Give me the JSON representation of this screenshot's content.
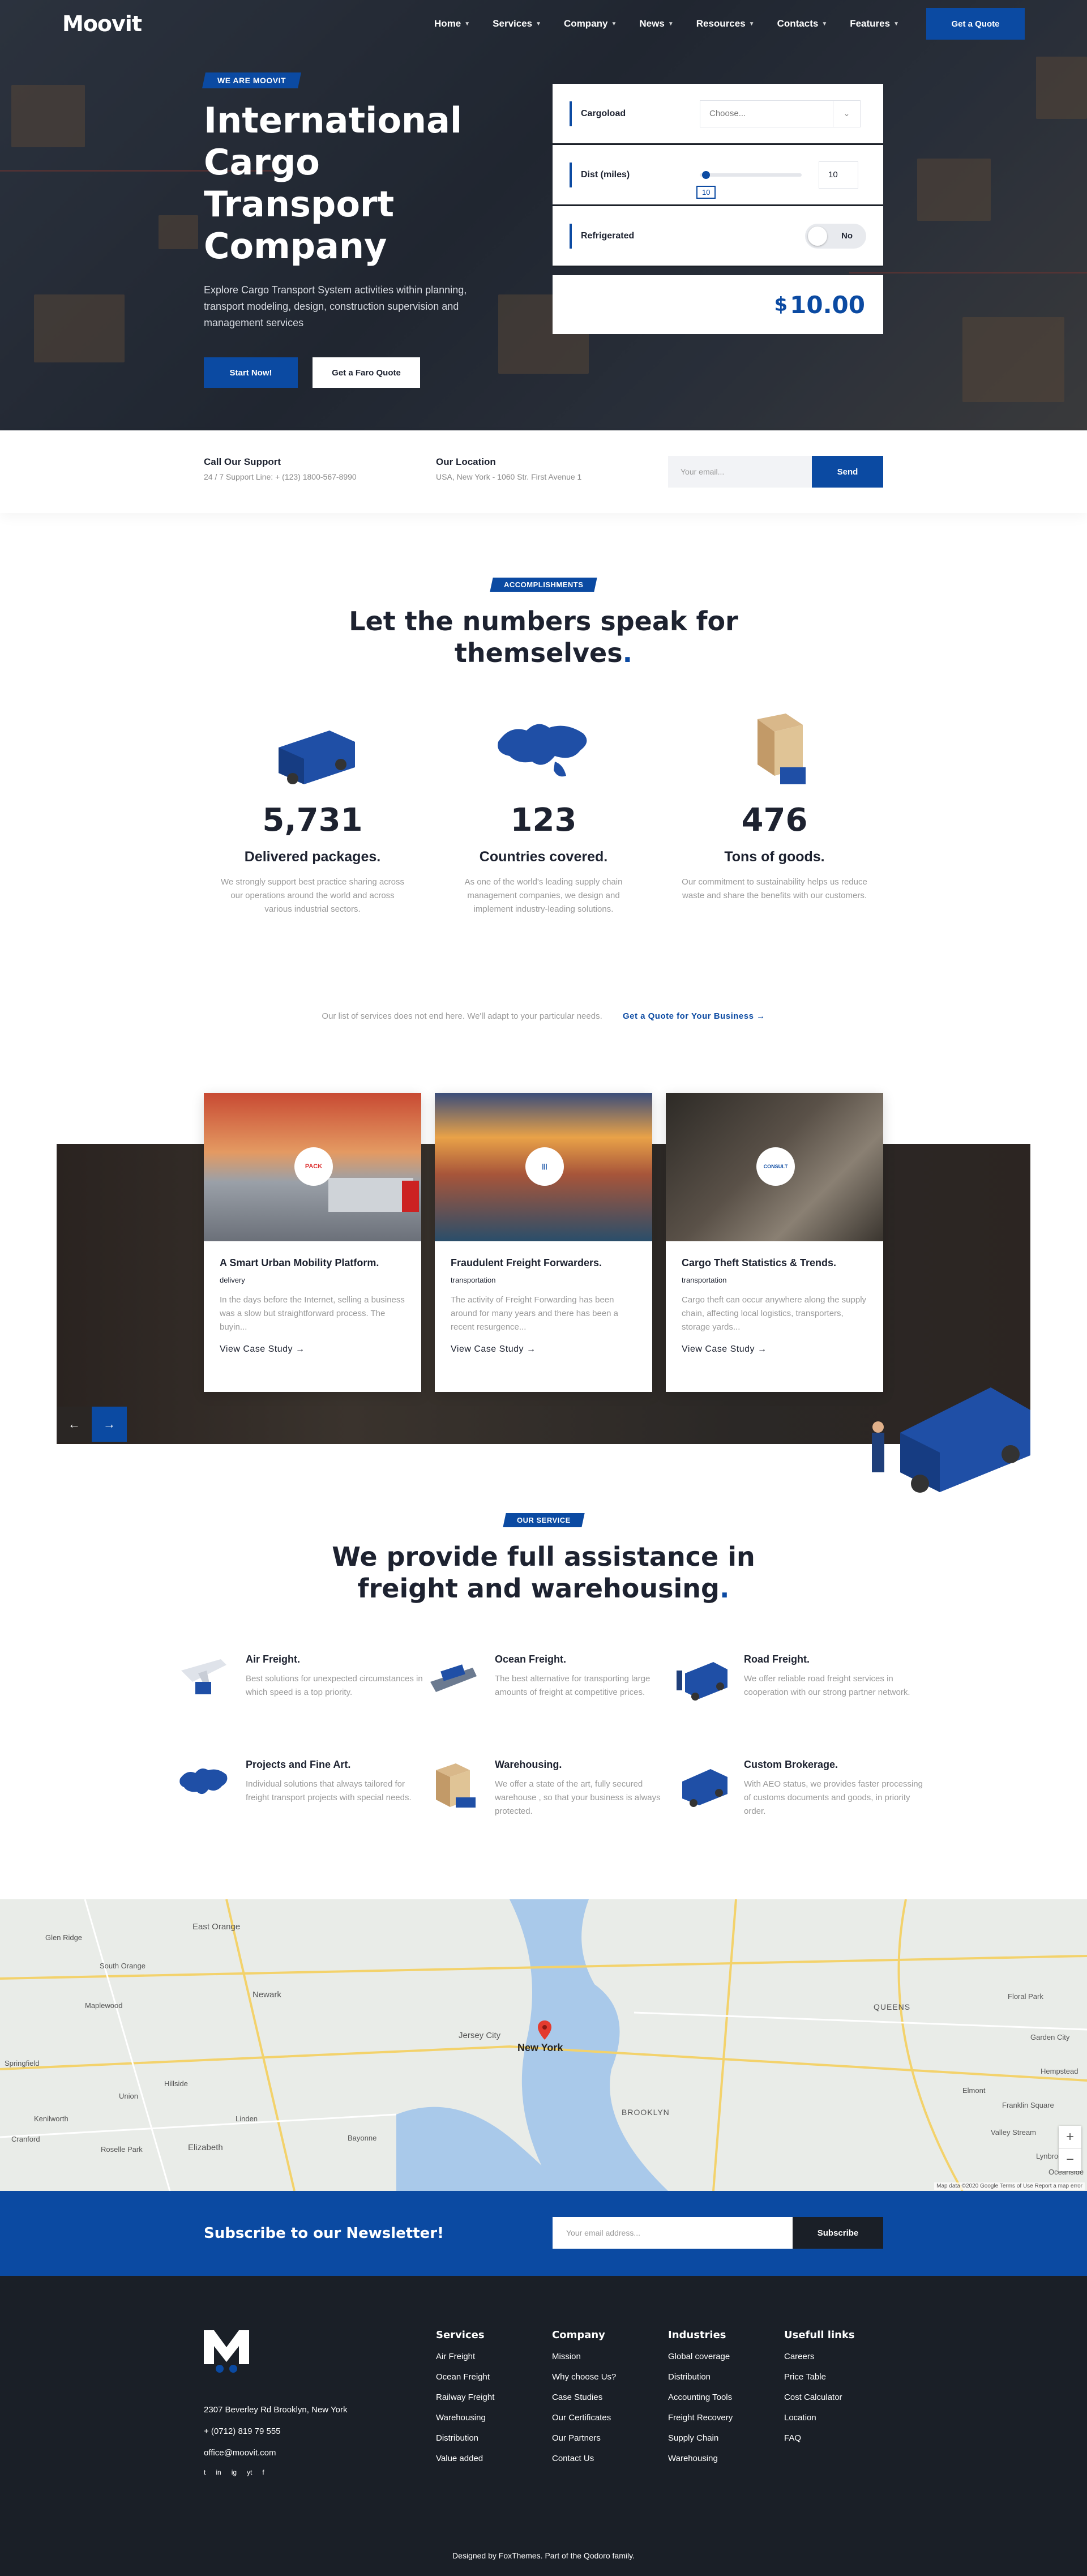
{
  "nav": {
    "logo": "Moovit",
    "items": [
      "Home",
      "Services",
      "Company",
      "News",
      "Resources",
      "Contacts",
      "Features"
    ],
    "quote_button": "Get a Quote"
  },
  "hero": {
    "tag": "WE ARE MOOVIT",
    "title_lines": [
      "International",
      "Cargo Transport",
      "Company"
    ],
    "subtitle": "Explore Cargo Transport System activities within planning, transport modeling, design, construction supervision and management services",
    "btn_primary": "Start Now!",
    "btn_secondary": "Get a Faro Quote"
  },
  "calculator": {
    "cargoload_label": "Cargoload",
    "cargoload_placeholder": "Choose...",
    "dist_label": "Dist (miles)",
    "dist_value": "10",
    "dist_tooltip": "10",
    "refrigerated_label": "Refrigerated",
    "refrigerated_value": "No",
    "total_currency": "$",
    "total_amount": "10.00"
  },
  "contact_bar": {
    "support_title": "Call Our Support",
    "support_text": "24 / 7 Support Line: + (123) 1800-567-8990",
    "location_title": "Our Location",
    "location_text": "USA, New York - 1060 Str. First Avenue 1",
    "email_placeholder": "Your email...",
    "send_label": "Send"
  },
  "accomplishments": {
    "tag": "ACCOMPLISHMENTS",
    "heading_lines": [
      "Let the numbers speak for",
      "themselves"
    ],
    "stats": [
      {
        "num": "5,731",
        "title": "Delivered packages.",
        "desc": "We strongly support best practice sharing across our operations around the world and across various industrial sectors."
      },
      {
        "num": "123",
        "title": "Countries covered.",
        "desc": "As one of the world's leading supply chain management companies, we design and implement industry-leading solutions."
      },
      {
        "num": "476",
        "title": "Tons of goods.",
        "desc": "Our commitment to sustainability helps us reduce waste and share the benefits with our customers."
      }
    ],
    "services_note": "Our list of services does not end here. We'll adapt to your particular needs.",
    "services_link": "Get a Quote for Your Business →"
  },
  "cases": [
    {
      "title": "A Smart Urban Mobility Platform.",
      "cat": "delivery",
      "desc": "In the days before the Internet, selling a business was a slow but straightforward process. The buyin...",
      "link": "View Case Study →",
      "badge": "PACK"
    },
    {
      "title": "Fraudulent Freight Forwarders.",
      "cat": "transportation",
      "desc": "The activity of Freight Forwarding has been around for many years and there has been a recent resurgence...",
      "link": "View Case Study →",
      "badge": "|||"
    },
    {
      "title": "Cargo Theft Statistics & Trends.",
      "cat": "transportation",
      "desc": "Cargo theft can occur anywhere along the supply chain, affecting local logistics, transporters, storage yards...",
      "link": "View Case Study →",
      "badge": "CONSULT"
    }
  ],
  "our_service": {
    "tag": "OUR SERVICE",
    "heading_lines": [
      "We provide full assistance in",
      "freight and warehousing"
    ],
    "items": [
      {
        "title": "Air Freight.",
        "desc": "Best solutions for unexpected circumstances in which speed is a top priority."
      },
      {
        "title": "Ocean Freight.",
        "desc": "The best alternative for transporting large amounts of freight at competitive prices."
      },
      {
        "title": "Road Freight.",
        "desc": "We offer reliable road freight services in cooperation with our strong partner network."
      },
      {
        "title": "Projects and Fine Art.",
        "desc": "Individual solutions that always tailored for freight transport projects with special needs."
      },
      {
        "title": "Warehousing.",
        "desc": "We offer a state of the art, fully secured warehouse , so that your business is always protected."
      },
      {
        "title": "Custom Brokerage.",
        "desc": "With AEO status, we provides faster processing of customs documents and goods, in priority order."
      }
    ]
  },
  "map": {
    "labels": [
      "East Orange",
      "Newark",
      "Jersey City",
      "New York",
      "QUEENS",
      "BROOKLYN",
      "Elizabeth",
      "Bayonne",
      "Maplewood",
      "Hillside",
      "Union",
      "Roselle Park",
      "Springfield",
      "Kenilworth",
      "Cranford",
      "Linden",
      "South Orange",
      "Glen Ridge",
      "Floral Park",
      "Hempstead",
      "Garden City",
      "Valley Stream",
      "Elmont",
      "Franklin Square",
      "Lynbrook",
      "Oceanside"
    ],
    "attribution": "Map data ©2020 Google   Terms of Use   Report a map error"
  },
  "newsletter": {
    "title": "Subscribe to our Newsletter!",
    "placeholder": "Your email address...",
    "button": "Subscribe"
  },
  "footer": {
    "address": "2307 Beverley Rd Brooklyn, New York",
    "phone": "+ (0712) 819 79 555",
    "email": "office@moovit.com",
    "social": [
      "t",
      "in",
      "ig",
      "yt",
      "f"
    ],
    "columns": [
      {
        "title": "Services",
        "items": [
          "Air Freight",
          "Ocean Freight",
          "Railway Freight",
          "Warehousing",
          "Distribution",
          "Value added"
        ]
      },
      {
        "title": "Company",
        "items": [
          "Mission",
          "Why choose Us?",
          "Case Studies",
          "Our Certificates",
          "Our Partners",
          "Contact Us"
        ]
      },
      {
        "title": "Industries",
        "items": [
          "Global coverage",
          "Distribution",
          "Accounting Tools",
          "Freight Recovery",
          "Supply Chain",
          "Warehousing"
        ]
      },
      {
        "title": "Usefull links",
        "items": [
          "Careers",
          "Price Table",
          "Cost Calculator",
          "Location",
          "FAQ"
        ]
      }
    ],
    "bottom": "Designed by FoxThemes. Part of the Qodoro family."
  },
  "colors": {
    "brand_blue": "#0b4aa2",
    "dark": "#1a1f27"
  }
}
